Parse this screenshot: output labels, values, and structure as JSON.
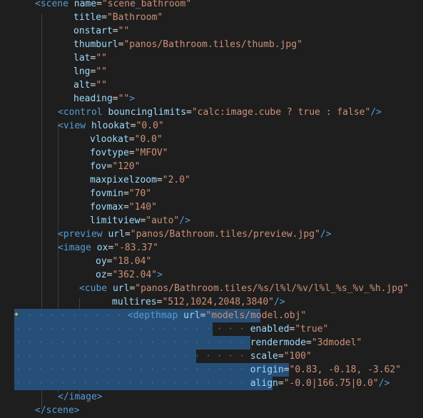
{
  "editor": {
    "lines": [
      {
        "indent": "scene",
        "tag_open": "<",
        "tag": "scene",
        "attr": "name",
        "value": "\"scene_bathroom\""
      },
      {
        "attr": "title",
        "value": "\"Bathroom\""
      },
      {
        "attr": "onstart",
        "value": "\"\""
      },
      {
        "attr": "thumburl",
        "value": "\"panos/Bathroom.tiles/thumb.jpg\""
      },
      {
        "attr": "lat",
        "value": "\"\""
      },
      {
        "attr": "lng",
        "value": "\"\""
      },
      {
        "attr": "alt",
        "value": "\"\""
      },
      {
        "attr": "heading",
        "value": "\"\"",
        "close": ">"
      },
      {
        "tag": "control",
        "attr": "bouncinglimits",
        "value": "\"calc:image.cube ? true : false\"",
        "close": "/>"
      },
      {
        "tag": "view",
        "attr": "hlookat",
        "value": "\"0.0\""
      },
      {
        "attr": "vlookat",
        "value": "\"0.0\""
      },
      {
        "attr": "fovtype",
        "value": "\"MFOV\""
      },
      {
        "attr": "fov",
        "value": "\"120\""
      },
      {
        "attr": "maxpixelzoom",
        "value": "\"2.0\""
      },
      {
        "attr": "fovmin",
        "value": "\"70\""
      },
      {
        "attr": "fovmax",
        "value": "\"140\""
      },
      {
        "attr": "limitview",
        "value": "\"auto\"",
        "close": "/>"
      },
      {
        "tag": "preview",
        "attr": "url",
        "value": "\"panos/Bathroom.tiles/preview.jpg\"",
        "close": "/>"
      },
      {
        "tag": "image",
        "attr": "ox",
        "value": "\"-83.37\""
      },
      {
        "attr": "oy",
        "value": "\"18.04\""
      },
      {
        "attr": "oz",
        "value": "\"362.04\"",
        "close": ">"
      },
      {
        "tag": "cube",
        "attr": "url",
        "value": "\"panos/Bathroom.tiles/%s/l%l/%v/l%l_%s_%v_%h.jpg\""
      },
      {
        "attr": "multires",
        "value": "\"512,1024,2048,3840\"",
        "close": "/>"
      },
      {
        "tag": "depthmap",
        "attr": "url",
        "value": "\"models/model.obj\""
      },
      {
        "attr": "enabled",
        "value": "\"true\""
      },
      {
        "attr": "rendermode",
        "value": "\"3dmodel\""
      },
      {
        "attr": "scale",
        "value": "\"100\""
      },
      {
        "attr": "origin",
        "value": "\"0.83, -0.18, -3.62\""
      },
      {
        "attr": "align",
        "value": "\"-0.0|166.75|0.0\"",
        "close": "/>"
      },
      {
        "closing_tag": "image"
      },
      {
        "closing_tag": "scene"
      }
    ]
  },
  "colors": {
    "background": "#1e1e1e",
    "tag": "#569cd6",
    "attribute": "#9cdcfe",
    "string": "#ce9178",
    "punctuation": "#808080",
    "selection": "#264f78"
  },
  "gutter_icon": "sparkle-icon"
}
